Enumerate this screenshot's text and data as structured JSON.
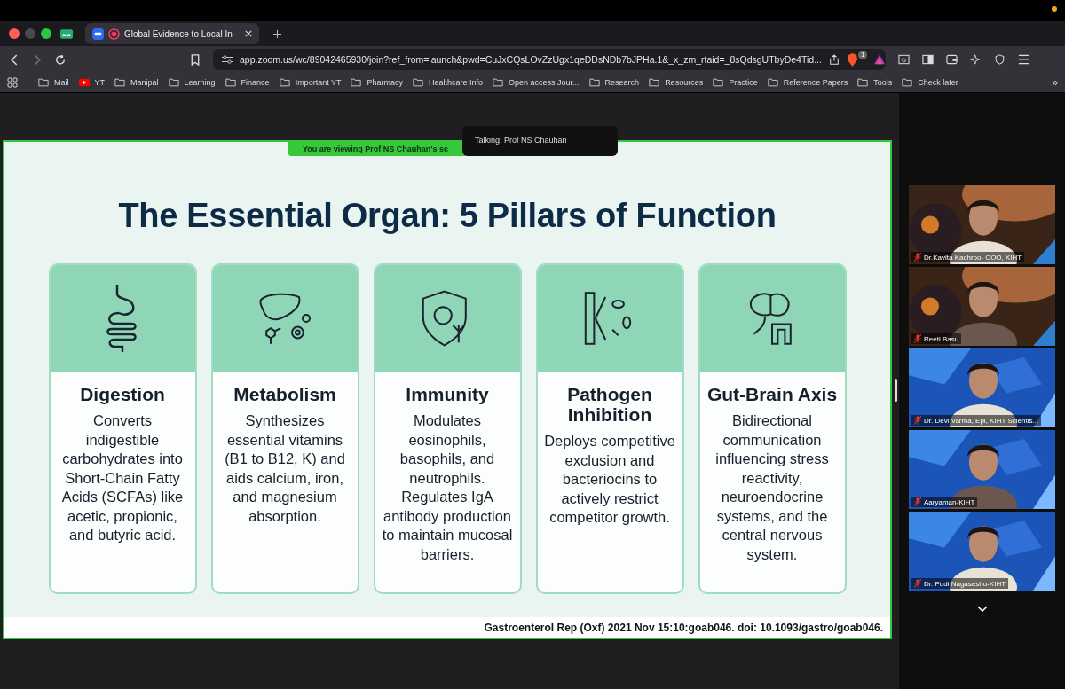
{
  "browser": {
    "tab": {
      "title": "Global Evidence to Local In",
      "selected": true
    },
    "url": "app.zoom.us/wc/89042465930/join?ref_from=launch&pwd=CuJxCQsLOvZzUgx1qeDDsNDb7bJPHa.1&_x_zm_rtaid=_8sQdsgUTbyDe4Tid...",
    "shield_badge": "1",
    "bookmarks": [
      {
        "label": "Mail",
        "kind": "folder"
      },
      {
        "label": "YT",
        "kind": "video"
      },
      {
        "label": "Manipal",
        "kind": "folder"
      },
      {
        "label": "Learning",
        "kind": "folder"
      },
      {
        "label": "Finance",
        "kind": "folder"
      },
      {
        "label": "Important YT",
        "kind": "folder"
      },
      {
        "label": "Pharmacy",
        "kind": "folder"
      },
      {
        "label": "Healthcare Info",
        "kind": "folder"
      },
      {
        "label": "Open access Jour...",
        "kind": "folder"
      },
      {
        "label": "Research",
        "kind": "folder"
      },
      {
        "label": "Resources",
        "kind": "folder"
      },
      {
        "label": "Practice",
        "kind": "folder"
      },
      {
        "label": "Reference Papers",
        "kind": "folder"
      },
      {
        "label": "Tools",
        "kind": "folder"
      },
      {
        "label": "Check later",
        "kind": "folder"
      }
    ],
    "more": "»"
  },
  "meeting": {
    "viewing_banner": "You are viewing  Prof NS Chauhan's sc",
    "talking": "Talking: Prof NS Chauhan",
    "slide": {
      "title": "The Essential Organ: 5 Pillars of Function",
      "pillars": [
        {
          "title": "Digestion",
          "text": "Converts indigestible carbohydrates into Short-Chain Fatty Acids (SCFAs) like acetic, propionic, and butyric acid."
        },
        {
          "title": "Metabolism",
          "text": "Synthesizes essential vitamins (B1 to B12, K) and aids calcium, iron, and magnesium absorption."
        },
        {
          "title": "Immunity",
          "text": "Modulates eosinophils, basophils, and neutrophils. Regulates IgA antibody production to maintain mucosal barriers."
        },
        {
          "title": "Pathogen Inhibition",
          "text": "Deploys competitive exclusion and bacteriocins to actively restrict competitor growth."
        },
        {
          "title": "Gut-Brain Axis",
          "text": "Bidirectional communication influencing stress reactivity, neuroendocrine systems, and the central nervous system."
        }
      ],
      "citation": "Gastroenterol Rep (Oxf)  2021 Nov 15:10:goab046. doi: 10.1093/gastro/goab046."
    },
    "participants": [
      {
        "name": "Dr.Kavita Kachroo- COO, KIHT",
        "muted": true
      },
      {
        "name": "Reeti Basu",
        "muted": true
      },
      {
        "name": "Dr. Devi Varma, Epi, KIHT Scientis...",
        "muted": true
      },
      {
        "name": "Aaryaman-KIHT",
        "muted": true
      },
      {
        "name": "Dr. Pudi Nagaseshu-KIHT",
        "muted": true
      }
    ]
  }
}
